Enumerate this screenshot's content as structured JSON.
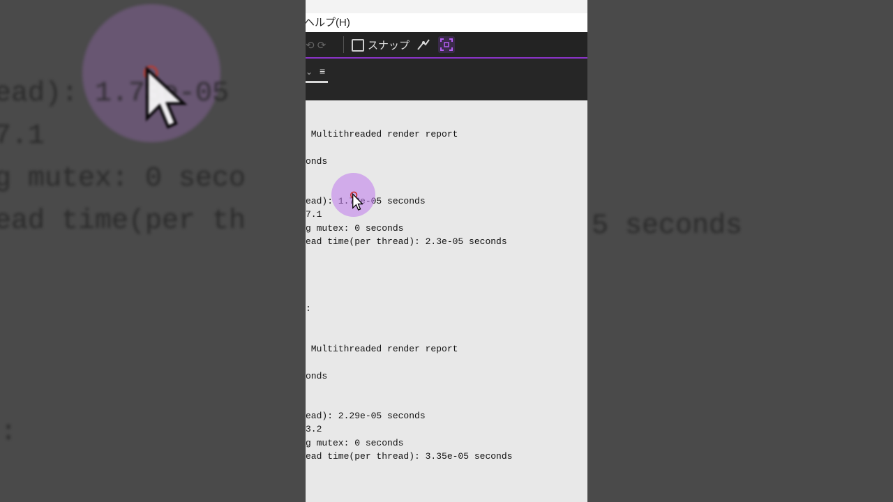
{
  "menu": {
    "help_label": "ヘルプ(H)"
  },
  "toolbar": {
    "snap_label": "スナップ",
    "icons": [
      "undo-icon",
      "rotate-icon",
      "snap-checkbox",
      "pen-tool-icon",
      "focus-tool-icon"
    ],
    "accent_color": "#8b33c9"
  },
  "panel": {
    "menu_icon": "≡"
  },
  "log": {
    "lines": [
      " Multithreaded render report",
      "onds",
      "ead): 1.73e-05 seconds",
      "7.1",
      "g mutex: 0 seconds",
      "ead time(per thread): 2.3e-05 seconds",
      ":",
      " Multithreaded render report",
      "onds",
      "ead): 2.29e-05 seconds",
      "3.2",
      "g mutex: 0 seconds",
      "ead time(per thread): 3.35e-05 seconds"
    ]
  },
  "background_zoom": {
    "lines": [
      "ead): 1.73e-05",
      "7.1",
      "g mutex: 0 seco",
      "ead time(per th"
    ],
    "right_fragment": "5 seconds",
    "colon": ":"
  },
  "cursor": {
    "highlight_color": "#be78eb"
  }
}
